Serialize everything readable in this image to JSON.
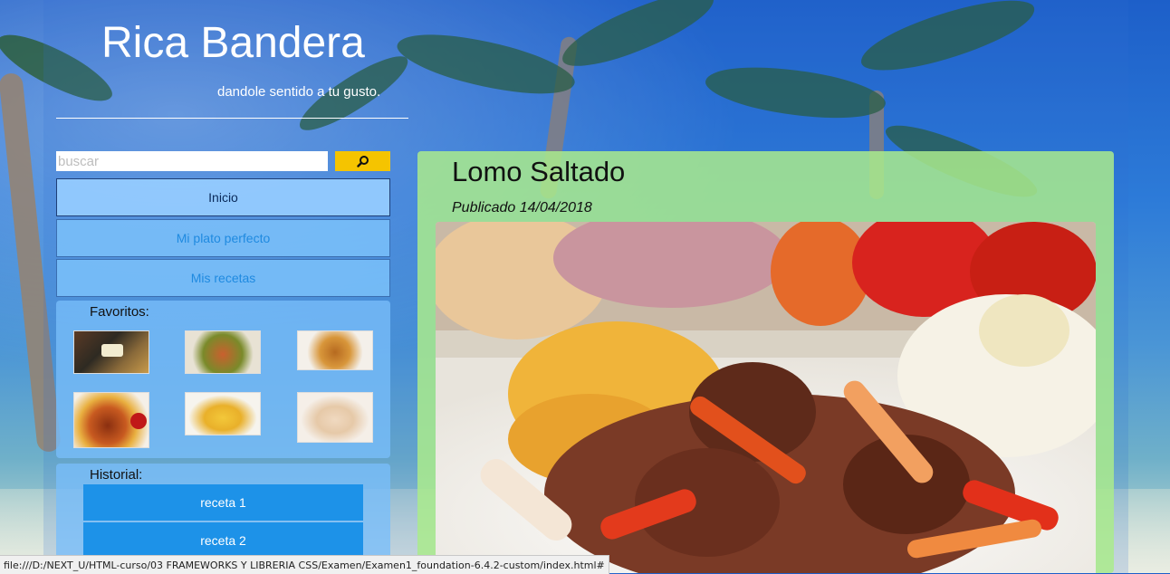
{
  "header": {
    "title": "Rica Bandera",
    "subtitle": "dandole sentido a tu gusto."
  },
  "search": {
    "placeholder": "buscar",
    "button_icon": "search-icon"
  },
  "nav": {
    "items": [
      {
        "label": "Inicio",
        "active": true
      },
      {
        "label": "Mi plato perfecto",
        "active": false
      },
      {
        "label": "Mis recetas",
        "active": false
      }
    ]
  },
  "favorites": {
    "label": "Favoritos:",
    "thumbnails": [
      "dish-photo-1",
      "dish-photo-2",
      "dish-photo-3",
      "dish-photo-4",
      "dish-photo-5",
      "dish-photo-6"
    ]
  },
  "history": {
    "label": "Historial:",
    "items": [
      "receta 1",
      "receta 2"
    ]
  },
  "article": {
    "title": "Lomo Saltado",
    "published": "Publicado 14/04/2018"
  },
  "status": {
    "url": "file:///D:/NEXT_U/HTML-curso/03 FRAMEWORKS Y LIBRERIA CSS/Examen/Examen1_foundation-6.4.2-custom/index.html#"
  },
  "colors": {
    "accent": "#f5c400",
    "history_button": "#1d92e8",
    "main_panel": "#aaeb8c",
    "nav_link": "#1f8ae0"
  }
}
